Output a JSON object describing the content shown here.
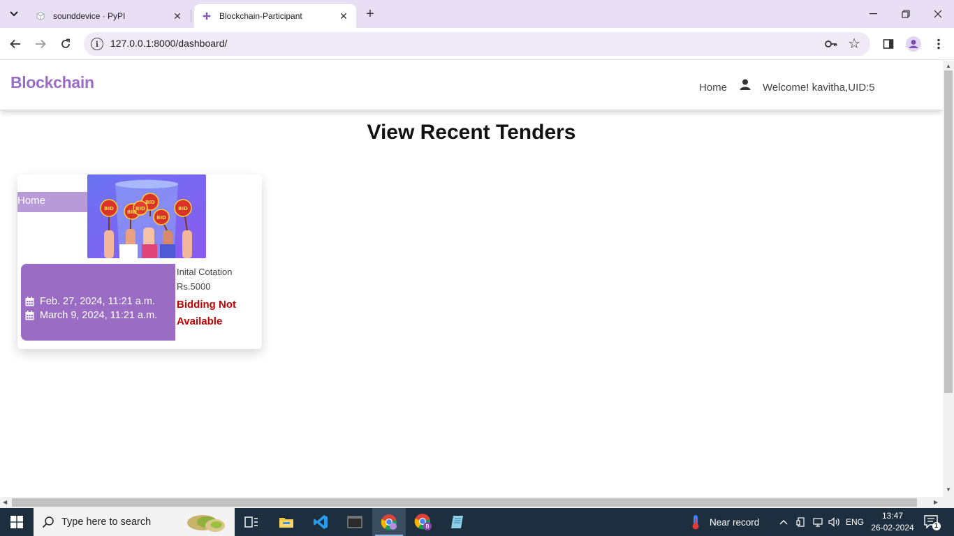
{
  "browser": {
    "tabs": [
      {
        "title": "sounddevice · PyPI",
        "active": false
      },
      {
        "title": "Blockchain-Participant",
        "active": true
      }
    ],
    "url": "127.0.0.1:8000/dashboard/"
  },
  "site": {
    "brand": "Blockchain",
    "nav": {
      "home": "Home",
      "welcome": "Welcome! kavitha,UID:5"
    },
    "page_title": "View Recent Tenders",
    "tender": {
      "home_label": "Home",
      "image_badges": [
        "BID",
        "BID",
        "BID",
        "BID",
        "BID",
        "BID"
      ],
      "start_date": "Feb. 27, 2024, 11:21 a.m.",
      "end_date": "March 9, 2024, 11:21 a.m.",
      "cotation_label": "Inital Cotation",
      "cotation_value": "Rs.5000",
      "status": "Bidding Not Available",
      "status_color": "#c00000"
    },
    "colors": {
      "brand": "#9b6cc4",
      "date_box": "#9b6cc4",
      "home_strip": "#b99ad8"
    }
  },
  "taskbar": {
    "search_placeholder": "Type here to search",
    "weather": "Near record",
    "language": "ENG",
    "time": "13:47",
    "date": "26-02-2024",
    "notification_count": "1"
  }
}
